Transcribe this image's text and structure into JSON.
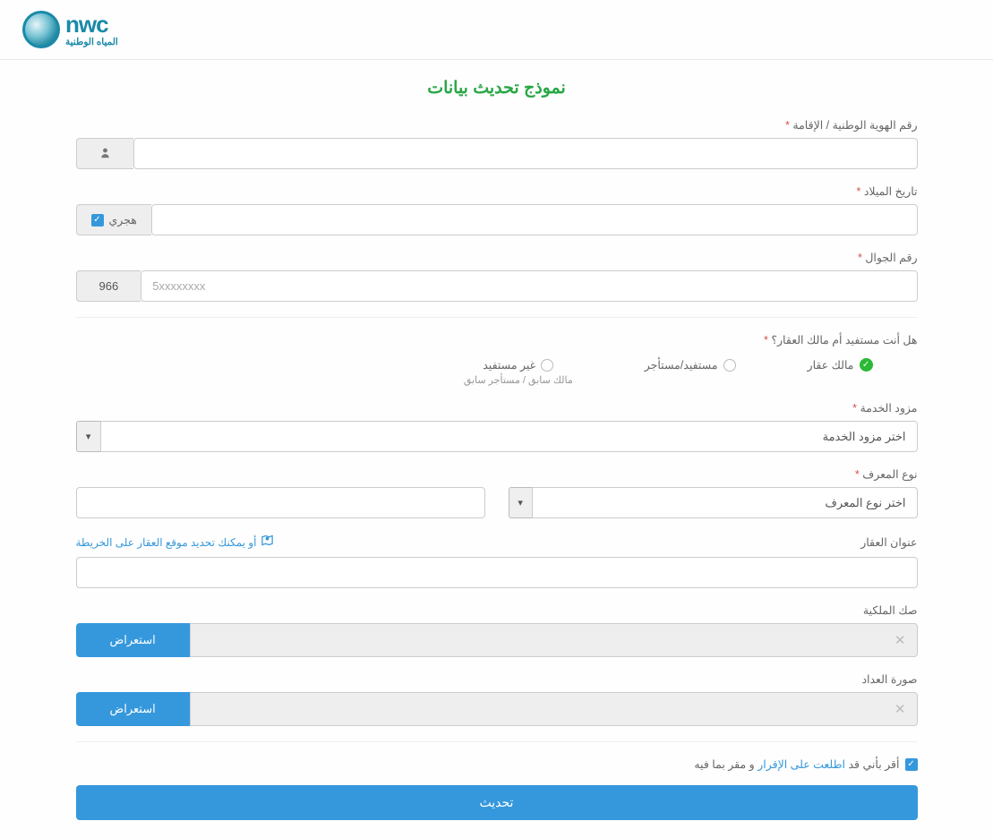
{
  "logo": {
    "brand": "nwc",
    "sub": "المياه الوطنية"
  },
  "title": "نموذج تحديث بيانات",
  "fields": {
    "identity_label": "رقم الهوية الوطنية / الإقامة",
    "birthdate_label": "تاريخ الميلاد",
    "hijri_label": "هجري",
    "mobile_label": "رقم الجوال",
    "mobile_placeholder": "5xxxxxxxx",
    "mobile_prefix": "966",
    "role_question": "هل أنت مستفيد أم مالك العقار؟",
    "role_owner": "مالك عقار",
    "role_beneficiary": "مستفيد/مستأجر",
    "role_nonbenef": "غير مستفيد",
    "role_nonbenef_sub": "مالك سابق / مستأجر سابق",
    "provider_label": "مزود الخدمة",
    "provider_placeholder": "اختر مزود الخدمة",
    "idtype_label": "نوع المعرف",
    "idtype_placeholder": "اختر نوع المعرف",
    "address_label": "عنوان العقار",
    "map_link_text": "أو يمكنك تحديد موقع العقار على الخريطة",
    "deed_label": "صك الملكية",
    "meter_label": "صورة العداد",
    "browse_btn": "استعراض",
    "ack_pre": "أقر بأني قد",
    "ack_link": "اطلعت على الإقرار",
    "ack_post": "و مقر بما فيه",
    "submit": "تحديث"
  }
}
